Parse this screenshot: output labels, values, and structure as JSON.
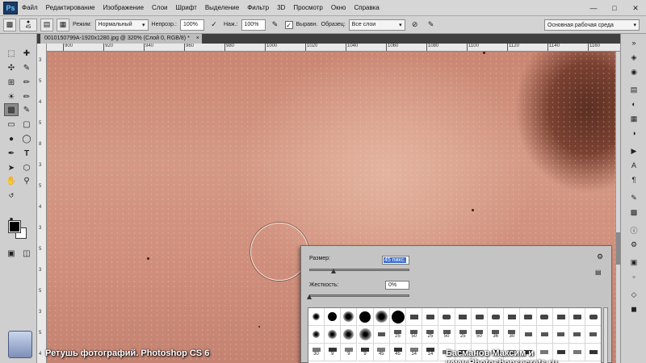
{
  "menubar": {
    "logo": "Ps",
    "items": [
      "Файл",
      "Редактирование",
      "Изображение",
      "Слои",
      "Шрифт",
      "Выделение",
      "Фильтр",
      "3D",
      "Просмотр",
      "Окно",
      "Справка"
    ]
  },
  "options": {
    "brush_size": "45",
    "mode_label": "Режим:",
    "mode_value": "Нормальный",
    "opacity_label": "Непрозр.:",
    "opacity_value": "100%",
    "flow_label": "Наж.:",
    "flow_value": "100%",
    "aligned_label": "Выравн.",
    "aligned_checked": "✓",
    "sample_label": "Образец:",
    "sample_value": "Все слои",
    "workspace_value": "Основная рабочая среда"
  },
  "document": {
    "tab_title": "0010150799A-1920x1280.jpg @ 320% (Слой 0, RGB/8) *",
    "close": "×"
  },
  "ruler_top_labels": [
    "900",
    "920",
    "940",
    "960",
    "980",
    "1000",
    "1020",
    "1040",
    "1060",
    "1080",
    "1100",
    "1120",
    "1140",
    "1160"
  ],
  "ruler_left_labels": [
    "3",
    "5",
    "4",
    "5",
    "8",
    "3",
    "5",
    "4",
    "3",
    "5",
    "3",
    "5",
    "3",
    "5",
    "4"
  ],
  "brush_picker": {
    "size_label": "Размер:",
    "size_value": "45 пикс.",
    "hardness_label": "Жесткость:",
    "hardness_value": "0%",
    "size_slider_level_percent": 24,
    "hardness_slider_level_percent": 0,
    "grid_row_numbers_1": [
      "25",
      "50",
      "25",
      "50",
      "25",
      "50",
      "36",
      "30"
    ],
    "grid_row_numbers_2": [
      "30",
      "9",
      "9",
      "9",
      "45",
      "45",
      "14",
      "14"
    ]
  },
  "captions": {
    "left": "Ретушь фотографий. Photoshop CS 6",
    "right": "Басманов Максим и www.Photoshopsecrets.ru"
  },
  "colors": {
    "foreground": "#000000",
    "background": "#ffffff",
    "skin": "#cf8e7b"
  }
}
